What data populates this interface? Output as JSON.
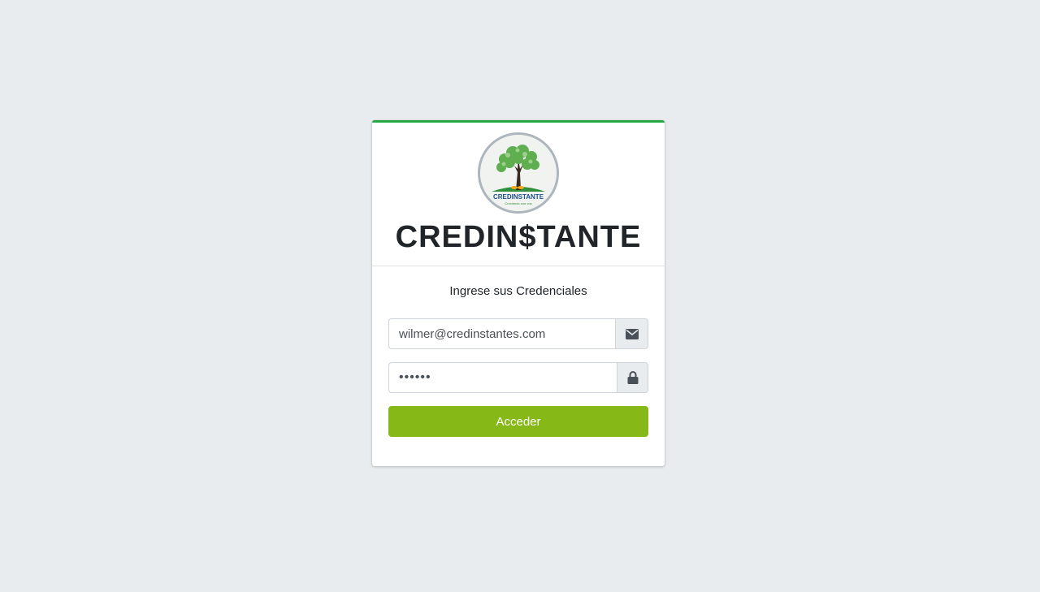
{
  "brand": {
    "title": "CREDIN$TANTE",
    "logo_text": "CREDINSTANTE",
    "logo_tagline": "Creciendo con vos"
  },
  "form": {
    "subtitle": "Ingrese sus Credenciales",
    "email": {
      "value": "wilmer@credinstantes.com",
      "icon": "envelope-icon"
    },
    "password": {
      "value": "123456",
      "icon": "lock-icon"
    },
    "submit_label": "Acceder"
  },
  "colors": {
    "accent_top_border": "#28a745",
    "button": "#86b817",
    "background": "#e9ecef"
  }
}
